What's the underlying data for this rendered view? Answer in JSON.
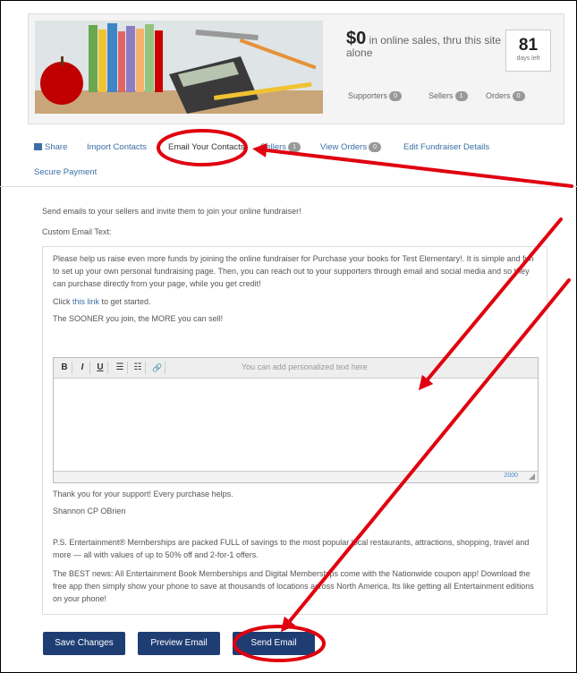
{
  "header": {
    "sales_amount": "$0",
    "sales_text": " in online sales, thru this site alone",
    "days_number": "81",
    "days_label": "days left",
    "supporters_label": "Supporters",
    "supporters_count": "0",
    "sellers_label": "Sellers",
    "sellers_count": "1",
    "orders_label": "Orders",
    "orders_count": "0"
  },
  "nav": {
    "share": "Share",
    "import_contacts": "Import Contacts",
    "email_contacts": "Email Your Contacts",
    "sellers": "Sellers",
    "sellers_count": "1",
    "view_orders": "View Orders",
    "orders_count": "0",
    "edit_details": "Edit Fundraiser Details",
    "secure_payment": "Secure Payment"
  },
  "intro_text": "Send emails to your sellers and invite them to join your online fundraiser!",
  "custom_label": "Custom Email Text:",
  "email": {
    "para1": "Please help us raise even more funds by joining the online fundraiser for Purchase your books for Test Elementary!. It is simple and fun to set up your own personal fundraising page. Then, you can reach out to your supporters through email and social media and so they can purchase directly from your page, while you get credit!",
    "click": "Click ",
    "link": "this link",
    "click_after": " to get started.",
    "sooner": "The SOONER you join, the MORE you can sell!",
    "editor_placeholder": "You can add personalized text here",
    "char_count": "2000",
    "thanks": "Thank you for your support! Every purchase helps.",
    "signature": "Shannon CP OBrien",
    "ps": "P.S. Entertainment® Memberships are packed FULL of savings to the most popular local restaurants, attractions, shopping, travel and more — all with values of up to 50% off and 2-for-1 offers.",
    "best": "The BEST news: All Entertainment Book Memberships and Digital Memberships come with the Nationwide coupon app! Download the free app then simply show your phone to save at thousands of locations across North America. Its like getting all Entertainment editions on your phone!"
  },
  "buttons": {
    "save": "Save Changes",
    "preview": "Preview Email",
    "send": "Send Email"
  },
  "toolbar": {
    "bold": "B",
    "italic": "I",
    "underline": "U",
    "bullets": "☰",
    "numbers": "☷",
    "link": "🔗"
  },
  "colors": {
    "annotation": "#e0000f",
    "button": "#1e3d73",
    "link": "#3a6ea5"
  }
}
